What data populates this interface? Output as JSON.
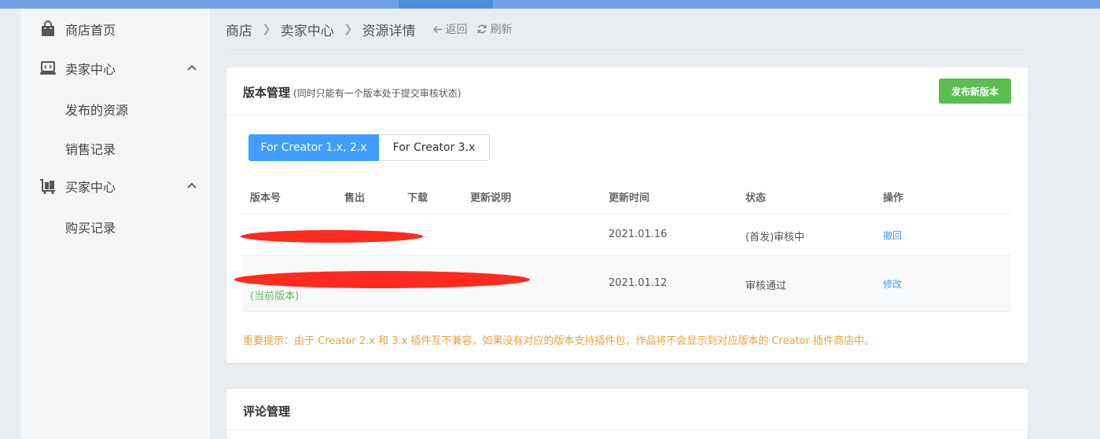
{
  "sidebar": {
    "items": [
      {
        "label": "商店首页",
        "icon": "shopping-bag-icon"
      },
      {
        "label": "卖家中心",
        "icon": "laptop-code-icon",
        "expanded": true
      },
      {
        "label": "发布的资源"
      },
      {
        "label": "销售记录"
      },
      {
        "label": "买家中心",
        "icon": "luggage-cart-icon",
        "expanded": true
      },
      {
        "label": "购买记录"
      }
    ]
  },
  "breadcrumb": {
    "items": [
      "商店",
      "卖家中心",
      "资源详情"
    ],
    "back_label": "返回",
    "refresh_label": "刷新"
  },
  "version_panel": {
    "title": "版本管理",
    "subtitle": "(同时只能有一个版本处于提交审核状态)",
    "publish_button": "发布新版本",
    "tabs": [
      {
        "label": "For Creator 1.x, 2.x",
        "active": true
      },
      {
        "label": "For Creator 3.x",
        "active": false
      }
    ],
    "table": {
      "headers": [
        "版本号",
        "售出",
        "下载",
        "更新说明",
        "更新时间",
        "状态",
        "操作"
      ],
      "rows": [
        {
          "version": "",
          "sold": "",
          "downloads": "",
          "notes": "",
          "date": "2021.01.16",
          "status": "(首发)审核中",
          "action": "撤回"
        },
        {
          "version": "",
          "sold": "",
          "downloads": "",
          "notes": "",
          "date": "2021.01.12",
          "status": "审核通过",
          "action": "修改",
          "tag": "(当前版本)"
        }
      ]
    },
    "warning": "重要提示：由于 Creator 2.x 和 3.x 插件互不兼容，如果没有对应的版本支持插件包，作品将不会显示到对应版本的 Creator 插件商店中。"
  },
  "comments_panel": {
    "title": "评论管理"
  },
  "colors": {
    "primary": "#409eff",
    "success": "#5cbd52",
    "warning": "#e6a23c",
    "redaction": "#ff2a1f"
  }
}
